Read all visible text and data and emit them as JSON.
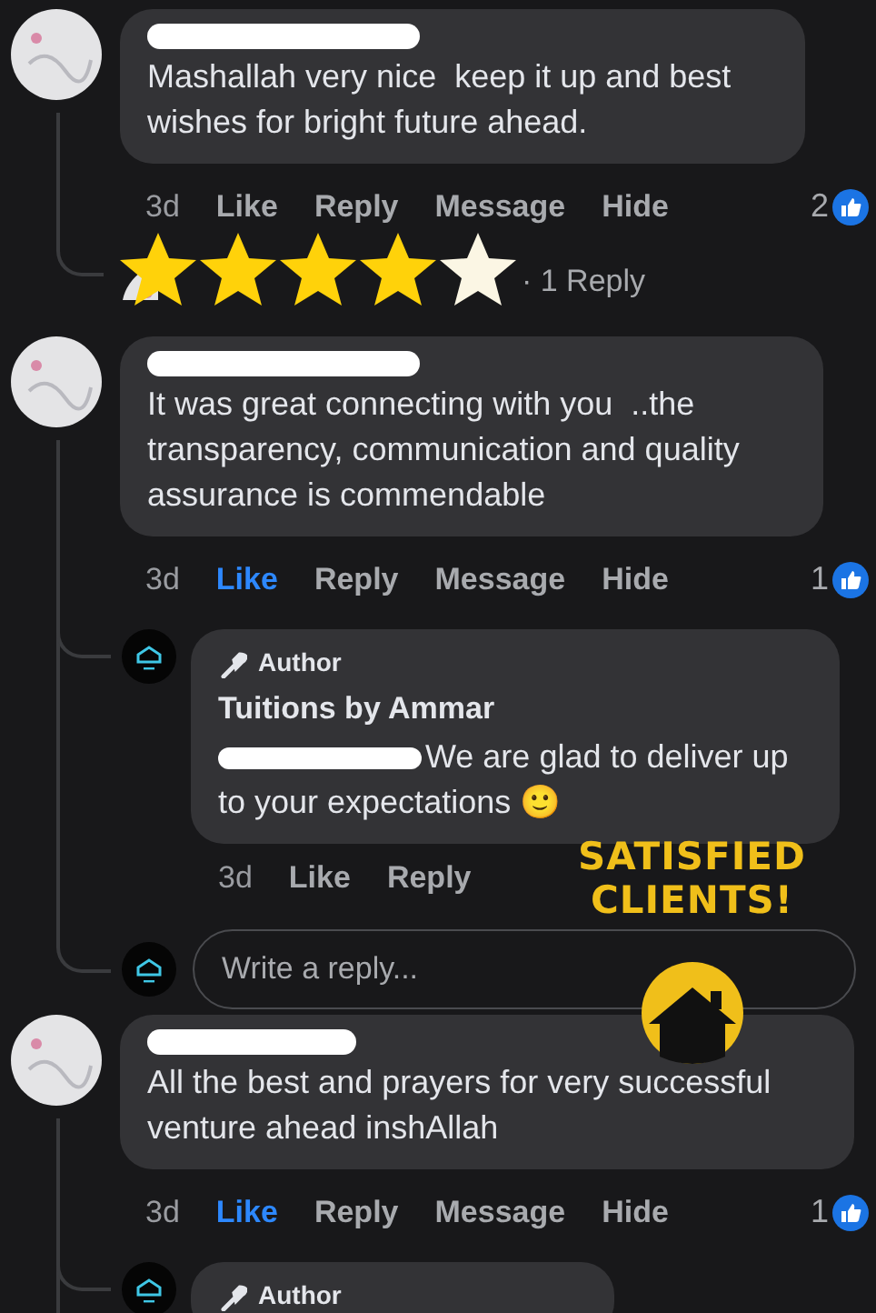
{
  "comments": [
    {
      "text": "Mashallah very nice  keep it up and best wishes for bright future ahead.",
      "time": "3d",
      "liked": false,
      "actions": [
        "Like",
        "Reply",
        "Message",
        "Hide"
      ],
      "reaction_count": "2",
      "replies_summary": "· 1 Reply"
    },
    {
      "text": "It was great connecting with you  ..the transparency, communication and quality assurance is commendable",
      "time": "3d",
      "liked": true,
      "actions": [
        "Like",
        "Reply",
        "Message",
        "Hide"
      ],
      "reaction_count": "1",
      "replies": [
        {
          "badge": "Author",
          "author": "Tuitions by Ammar",
          "text": "We are glad to deliver up to your expectations 🙂",
          "time": "3d",
          "liked": false,
          "actions": [
            "Like",
            "Reply"
          ]
        }
      ],
      "reply_field": {
        "placeholder": "Write a reply..."
      }
    },
    {
      "text": "All the best and prayers for very successful venture ahead inshAllah",
      "time": "3d",
      "liked": true,
      "actions": [
        "Like",
        "Reply",
        "Message",
        "Hide"
      ],
      "reaction_count": "1",
      "replies": [
        {
          "badge": "Author"
        }
      ]
    }
  ],
  "rating_overlay": {
    "stars": 4
  },
  "sticker": {
    "lines": [
      "SATISFIED",
      "CLIENTS!"
    ]
  }
}
